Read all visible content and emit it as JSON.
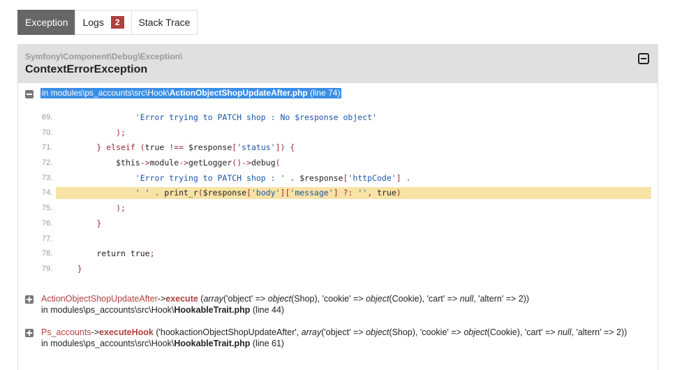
{
  "tabs": [
    {
      "label": "Exception"
    },
    {
      "label": "Logs",
      "badge": "2"
    },
    {
      "label": "Stack Trace"
    }
  ],
  "exception": {
    "namespace": "Symfony\\Component\\Debug\\Exception\\",
    "class": "ContextErrorException"
  },
  "file": {
    "prefix": "in modules\\ps_accounts\\src\\Hook\\",
    "name": "ActionObjectShopUpdateAfter.php",
    "suffix": " (line 74)"
  },
  "code_lines": [
    {
      "n": "69.",
      "segs": [
        {
          "t": "                ",
          "c": "tx"
        },
        {
          "t": "'Error trying to PATCH shop : No $response object'",
          "c": "str"
        }
      ]
    },
    {
      "n": "70.",
      "segs": [
        {
          "t": "            );",
          "c": "kw"
        }
      ]
    },
    {
      "n": "71.",
      "segs": [
        {
          "t": "        } elseif (",
          "c": "kw"
        },
        {
          "t": "true",
          "c": "tx"
        },
        {
          "t": " !== ",
          "c": "kw"
        },
        {
          "t": "$response",
          "c": "tx"
        },
        {
          "t": "[",
          "c": "kw"
        },
        {
          "t": "'status'",
          "c": "str"
        },
        {
          "t": "]) {",
          "c": "kw"
        }
      ]
    },
    {
      "n": "72.",
      "segs": [
        {
          "t": "            ",
          "c": "tx"
        },
        {
          "t": "$this",
          "c": "tx"
        },
        {
          "t": "->",
          "c": "kw"
        },
        {
          "t": "module",
          "c": "tx"
        },
        {
          "t": "->",
          "c": "kw"
        },
        {
          "t": "getLogger",
          "c": "tx"
        },
        {
          "t": "()->",
          "c": "kw"
        },
        {
          "t": "debug",
          "c": "tx"
        },
        {
          "t": "(",
          "c": "kw"
        }
      ]
    },
    {
      "n": "73.",
      "segs": [
        {
          "t": "                ",
          "c": "tx"
        },
        {
          "t": "'Error trying to PATCH shop : '",
          "c": "str"
        },
        {
          "t": " . ",
          "c": "kw"
        },
        {
          "t": "$response",
          "c": "tx"
        },
        {
          "t": "[",
          "c": "kw"
        },
        {
          "t": "'httpCode'",
          "c": "str"
        },
        {
          "t": "] .",
          "c": "kw"
        }
      ]
    },
    {
      "n": "74.",
      "hl": true,
      "segs": [
        {
          "t": "                ",
          "c": "tx"
        },
        {
          "t": "' '",
          "c": "str"
        },
        {
          "t": " . ",
          "c": "kw"
        },
        {
          "t": "print_r",
          "c": "tx"
        },
        {
          "t": "(",
          "c": "kw"
        },
        {
          "t": "$response",
          "c": "tx"
        },
        {
          "t": "[",
          "c": "kw"
        },
        {
          "t": "'body'",
          "c": "str"
        },
        {
          "t": "][",
          "c": "kw"
        },
        {
          "t": "'message'",
          "c": "str"
        },
        {
          "t": "] ?: ",
          "c": "kw"
        },
        {
          "t": "''",
          "c": "str"
        },
        {
          "t": ", ",
          "c": "kw"
        },
        {
          "t": "true",
          "c": "tx"
        },
        {
          "t": ")",
          "c": "kw"
        }
      ]
    },
    {
      "n": "75.",
      "segs": [
        {
          "t": "            );",
          "c": "kw"
        }
      ]
    },
    {
      "n": "76.",
      "segs": [
        {
          "t": "        }",
          "c": "kw"
        }
      ]
    },
    {
      "n": "77.",
      "segs": []
    },
    {
      "n": "78.",
      "segs": [
        {
          "t": "        ",
          "c": "tx"
        },
        {
          "t": "return true",
          "c": "tx"
        },
        {
          "t": ";",
          "c": "kw"
        }
      ]
    },
    {
      "n": "79.",
      "segs": [
        {
          "t": "    }",
          "c": "kw"
        }
      ]
    }
  ],
  "trace": [
    {
      "class": "ActionObjectShopUpdateAfter",
      "arrow": "->",
      "method": "execute",
      "args_open": " (",
      "args": [
        {
          "t": "array",
          "i": true
        },
        {
          "t": "('object' => ",
          "i": false
        },
        {
          "t": "object",
          "i": true
        },
        {
          "t": "(Shop), 'cookie' => ",
          "i": false
        },
        {
          "t": "object",
          "i": true
        },
        {
          "t": "(Cookie), 'cart' => ",
          "i": false
        },
        {
          "t": "null",
          "i": true
        },
        {
          "t": ", 'altern' => 2))",
          "i": false
        }
      ],
      "loc_prefix": "in modules\\ps_accounts\\src\\Hook\\",
      "loc_file": "HookableTrait.php",
      "loc_suffix": " (line 44)"
    },
    {
      "class": "Ps_accounts",
      "arrow": "->",
      "method": "executeHook",
      "args_open": " (",
      "args": [
        {
          "t": "'hookactionObjectShopUpdateAfter', ",
          "i": false
        },
        {
          "t": "array",
          "i": true
        },
        {
          "t": "('object' => ",
          "i": false
        },
        {
          "t": "object",
          "i": true
        },
        {
          "t": "(Shop), 'cookie' => ",
          "i": false
        },
        {
          "t": "object",
          "i": true
        },
        {
          "t": "(Cookie), 'cart' => ",
          "i": false
        },
        {
          "t": "null",
          "i": true
        },
        {
          "t": ", 'altern' => 2))",
          "i": false
        }
      ],
      "loc_prefix": "in modules\\ps_accounts\\src\\Hook\\",
      "loc_file": "HookableTrait.php",
      "loc_suffix": " (line 61)"
    }
  ]
}
